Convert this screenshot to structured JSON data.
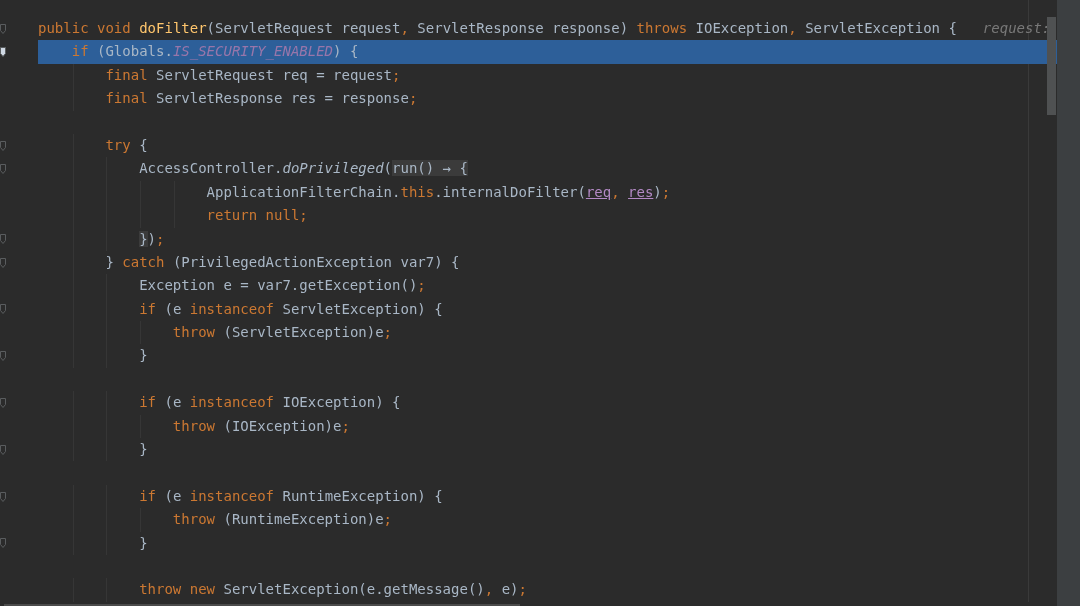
{
  "editor": {
    "lines": [
      {
        "selected": false,
        "fold": true,
        "tokens": [
          {
            "kind": "k",
            "text": "public "
          },
          {
            "kind": "k",
            "text": "void "
          },
          {
            "kind": "f",
            "text": "doFilter"
          },
          {
            "kind": "t",
            "text": "(ServletRequest request"
          },
          {
            "kind": "p",
            "text": ","
          },
          {
            "kind": "t",
            "text": " ServletResponse response) "
          },
          {
            "kind": "k",
            "text": "throws"
          },
          {
            "kind": "t",
            "text": " IOException"
          },
          {
            "kind": "p",
            "text": ","
          },
          {
            "kind": "t",
            "text": " ServletException {"
          }
        ],
        "hint": "request:"
      },
      {
        "selected": true,
        "fold": true,
        "tokens": [
          {
            "kind": "k",
            "text": "    if"
          },
          {
            "kind": "t",
            "text": " (Globals."
          },
          {
            "kind": "s",
            "text": "IS_SECURITY_ENABLED"
          },
          {
            "kind": "t",
            "text": ") {"
          }
        ]
      },
      {
        "selected": false,
        "fold": false,
        "tokens": [
          {
            "kind": "k",
            "text": "        final"
          },
          {
            "kind": "t",
            "text": " ServletRequest req = request"
          },
          {
            "kind": "p",
            "text": ";"
          }
        ]
      },
      {
        "selected": false,
        "fold": false,
        "tokens": [
          {
            "kind": "k",
            "text": "        final"
          },
          {
            "kind": "t",
            "text": " ServletResponse res = response"
          },
          {
            "kind": "p",
            "text": ";"
          }
        ]
      },
      {
        "selected": false,
        "fold": false
      },
      {
        "selected": false,
        "fold": true,
        "tokens": [
          {
            "kind": "k",
            "text": "        try"
          },
          {
            "kind": "t",
            "text": " {"
          }
        ]
      },
      {
        "selected": false,
        "fold": true,
        "tokens": [
          {
            "kind": "t",
            "text": "            AccessController."
          },
          {
            "kind": "i",
            "text": "doPrivileged"
          },
          {
            "kind": "t",
            "text": "("
          },
          {
            "kind": "l",
            "text": "run() → {"
          }
        ]
      },
      {
        "selected": false,
        "fold": false,
        "tokens": [
          {
            "kind": "t",
            "text": "                    ApplicationFilterChain."
          },
          {
            "kind": "k",
            "text": "this"
          },
          {
            "kind": "t",
            "text": ".internalDoFilter("
          },
          {
            "kind": "u",
            "text": "req"
          },
          {
            "kind": "p",
            "text": ", "
          },
          {
            "kind": "u",
            "text": "res"
          },
          {
            "kind": "t",
            "text": ")"
          },
          {
            "kind": "p",
            "text": ";"
          }
        ]
      },
      {
        "selected": false,
        "fold": false,
        "tokens": [
          {
            "kind": "k",
            "text": "                    return "
          },
          {
            "kind": "k",
            "text": "null"
          },
          {
            "kind": "p",
            "text": ";"
          }
        ]
      },
      {
        "selected": false,
        "fold": true,
        "tokens": [
          {
            "kind": "l",
            "text": "            }"
          },
          {
            "kind": "t",
            "text": ")"
          },
          {
            "kind": "p",
            "text": ";"
          }
        ]
      },
      {
        "selected": false,
        "fold": true,
        "tokens": [
          {
            "kind": "t",
            "text": "        } "
          },
          {
            "kind": "k",
            "text": "catch"
          },
          {
            "kind": "t",
            "text": " (PrivilegedActionException var7) {"
          }
        ]
      },
      {
        "selected": false,
        "fold": false,
        "tokens": [
          {
            "kind": "t",
            "text": "            Exception e = var7.getException()"
          },
          {
            "kind": "p",
            "text": ";"
          }
        ]
      },
      {
        "selected": false,
        "fold": true,
        "tokens": [
          {
            "kind": "k",
            "text": "            if"
          },
          {
            "kind": "t",
            "text": " (e "
          },
          {
            "kind": "k",
            "text": "instanceof"
          },
          {
            "kind": "t",
            "text": " ServletException) {"
          }
        ]
      },
      {
        "selected": false,
        "fold": false,
        "tokens": [
          {
            "kind": "k",
            "text": "                throw"
          },
          {
            "kind": "t",
            "text": " (ServletException)e"
          },
          {
            "kind": "p",
            "text": ";"
          }
        ]
      },
      {
        "selected": false,
        "fold": true,
        "tokens": [
          {
            "kind": "t",
            "text": "            }"
          }
        ]
      },
      {
        "selected": false,
        "fold": false
      },
      {
        "selected": false,
        "fold": true,
        "tokens": [
          {
            "kind": "k",
            "text": "            if"
          },
          {
            "kind": "t",
            "text": " (e "
          },
          {
            "kind": "k",
            "text": "instanceof"
          },
          {
            "kind": "t",
            "text": " IOException) {"
          }
        ]
      },
      {
        "selected": false,
        "fold": false,
        "tokens": [
          {
            "kind": "k",
            "text": "                throw"
          },
          {
            "kind": "t",
            "text": " (IOException)e"
          },
          {
            "kind": "p",
            "text": ";"
          }
        ]
      },
      {
        "selected": false,
        "fold": true,
        "tokens": [
          {
            "kind": "t",
            "text": "            }"
          }
        ]
      },
      {
        "selected": false,
        "fold": false
      },
      {
        "selected": false,
        "fold": true,
        "tokens": [
          {
            "kind": "k",
            "text": "            if"
          },
          {
            "kind": "t",
            "text": " (e "
          },
          {
            "kind": "k",
            "text": "instanceof"
          },
          {
            "kind": "t",
            "text": " RuntimeException) {"
          }
        ]
      },
      {
        "selected": false,
        "fold": false,
        "tokens": [
          {
            "kind": "k",
            "text": "                throw"
          },
          {
            "kind": "t",
            "text": " (RuntimeException)e"
          },
          {
            "kind": "p",
            "text": ";"
          }
        ]
      },
      {
        "selected": false,
        "fold": true,
        "tokens": [
          {
            "kind": "t",
            "text": "            }"
          }
        ]
      },
      {
        "selected": false,
        "fold": false
      },
      {
        "selected": false,
        "fold": false,
        "tokens": [
          {
            "kind": "k",
            "text": "            throw "
          },
          {
            "kind": "k",
            "text": "new"
          },
          {
            "kind": "t",
            "text": " ServletException(e.getMessage()"
          },
          {
            "kind": "p",
            "text": ","
          },
          {
            "kind": "t",
            "text": " e)"
          },
          {
            "kind": "p",
            "text": ";"
          }
        ]
      }
    ]
  }
}
